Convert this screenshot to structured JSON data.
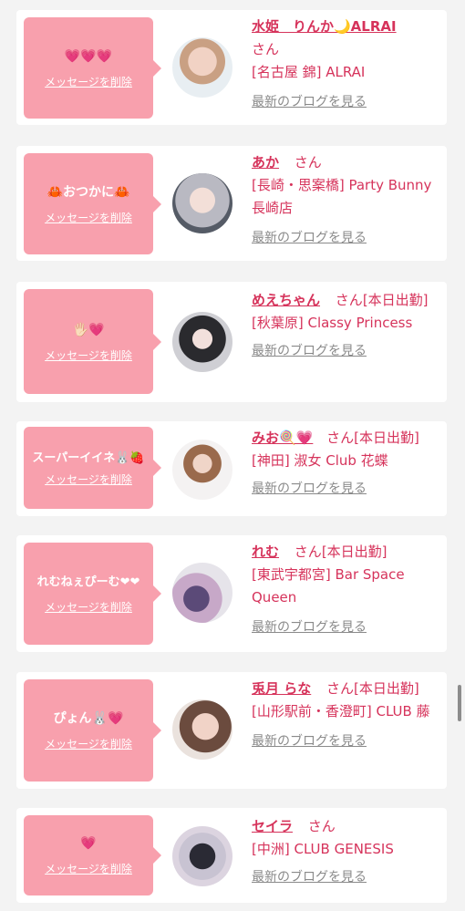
{
  "delete_label": "メッセージを削除",
  "blog_label": "最新のブログを見る",
  "san": "さん",
  "cards": [
    {
      "message": "💗💗💗",
      "name": "水姫　りんか🌙ALRAI",
      "tail": "",
      "shop": "[名古屋 錦] ALRAI"
    },
    {
      "message": "🦀おつかに🦀",
      "name": "あか",
      "tail": "",
      "shop": "[長崎・思案橋] Party Bunny 長崎店"
    },
    {
      "message": "🖐🏻💗",
      "name": "めえちゃん",
      "tail": "[本日出勤]",
      "shop": "[秋葉原] Classy Princess"
    },
    {
      "message": "スーパーイイネ🐰🍓",
      "name": "みお🍭💗",
      "tail": "[本日出勤]",
      "shop": "[神田] 淑女 Club 花蝶"
    },
    {
      "message": "れむねぇぴーむ❤❤",
      "name": "れむ",
      "tail": "[本日出勤]",
      "shop": "[東武宇都宮] Bar Space Queen"
    },
    {
      "message": "ぴょん🐰💗",
      "name": "兎月 らな",
      "tail": "[本日出勤]",
      "shop": "[山形駅前・香澄町] CLUB 藤"
    },
    {
      "message": "💗",
      "name": "セイラ",
      "tail": "",
      "shop": "[中洲] CLUB GENESIS"
    }
  ],
  "colors": {
    "bubble": "#f8a0ad",
    "accent": "#d6335b",
    "link_gray": "#8a8a8a"
  }
}
